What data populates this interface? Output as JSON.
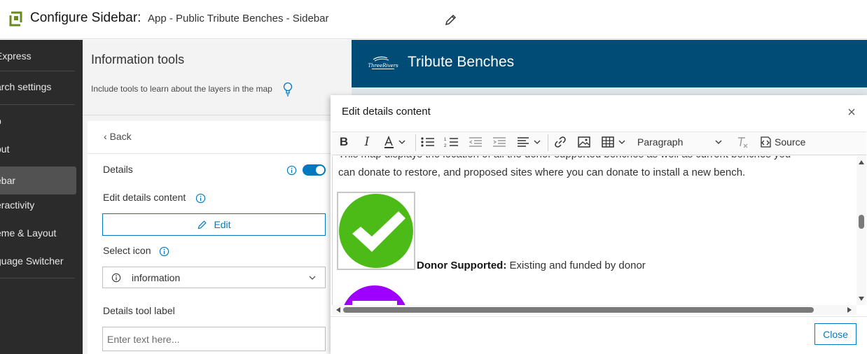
{
  "header": {
    "title": "Configure Sidebar:",
    "subtitle": "App - Public Tribute Benches - Sidebar"
  },
  "leftnav": {
    "items": [
      {
        "label": "Express",
        "active": false
      },
      {
        "label": "arch settings",
        "active": false
      },
      {
        "label": "p",
        "active": false
      },
      {
        "label": "out",
        "active": false
      },
      {
        "label": "ebar",
        "active": true
      },
      {
        "label": "eractivity",
        "active": false
      },
      {
        "label": "eme & Layout",
        "active": false
      },
      {
        "label": "guage Switcher",
        "active": false
      }
    ]
  },
  "panel": {
    "title": "Information tools",
    "description": "Include tools to learn about the layers in the map",
    "back_label": "Back",
    "details_label": "Details",
    "details_enabled": true,
    "edit_content_label": "Edit details content",
    "edit_button_label": "Edit",
    "select_icon_label": "Select icon",
    "select_icon_value": "information",
    "tool_label": "Details tool label",
    "tool_label_placeholder": "Enter text here..."
  },
  "preview": {
    "app_title": "Tribute Benches",
    "logo_text": "ThreeRivers"
  },
  "modal": {
    "title": "Edit details content",
    "toolbar": {
      "paragraph_label": "Paragraph",
      "source_label": "Source"
    },
    "content": {
      "line1": "This map displays the location of all the donor supported benches as well as current benches you",
      "line2": "can donate to restore, and proposed sites where you can donate to install a new bench.",
      "donor_bold": "Donor Supported:",
      "donor_text": " Existing and funded by donor"
    },
    "close_label": "Close"
  },
  "colors": {
    "accent": "#007ac2",
    "banner": "#004c77",
    "nav_bg": "#2b2b2b",
    "check_green": "#4cbb17",
    "purple": "#9d00ff"
  }
}
